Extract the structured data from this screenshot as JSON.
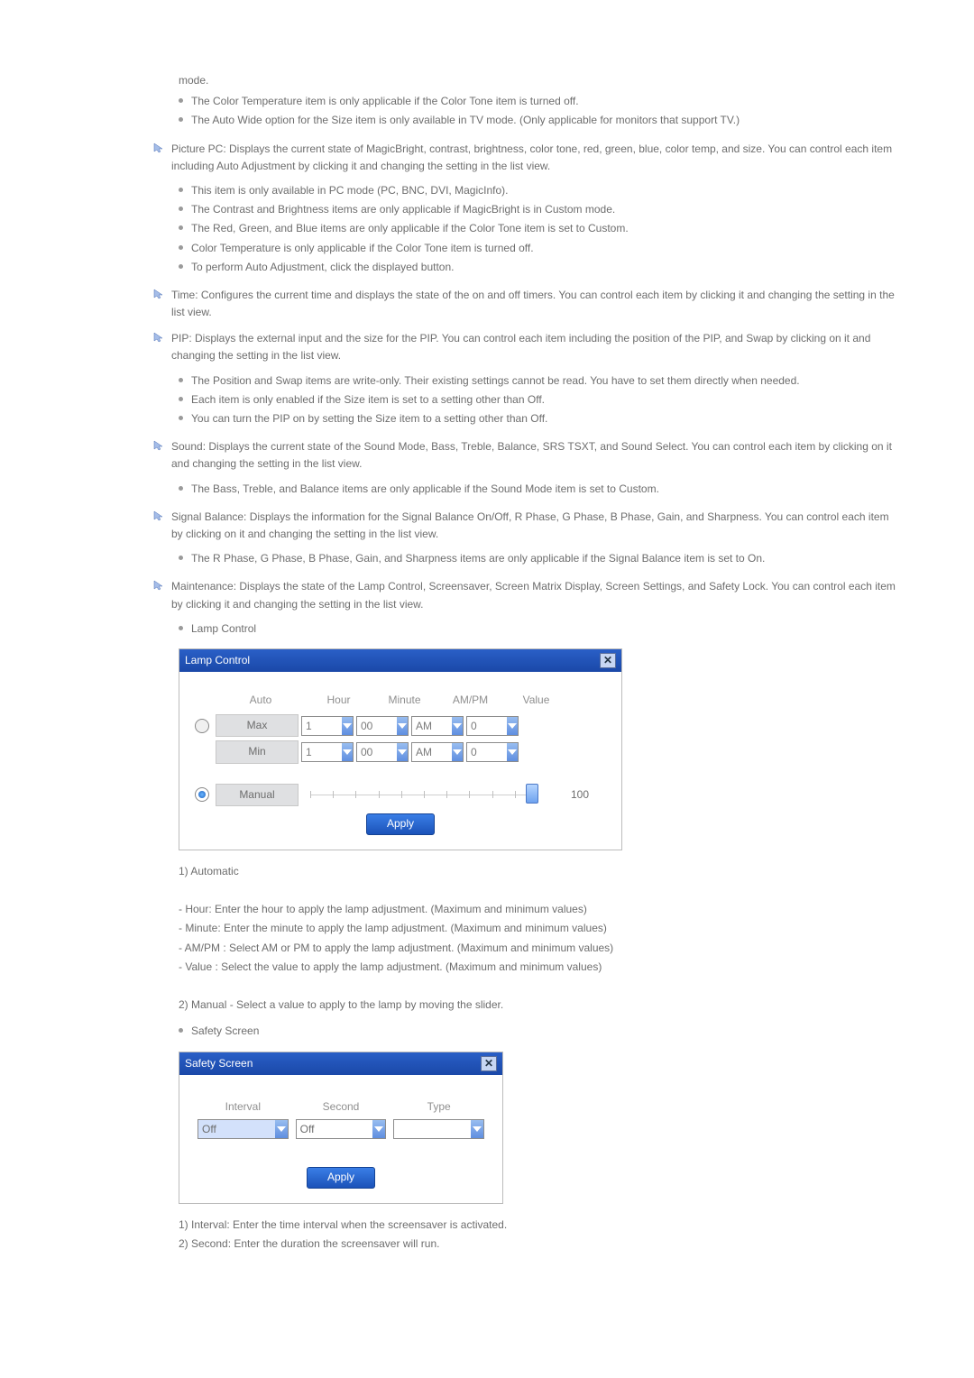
{
  "intro_tail_line": "mode.",
  "intro_bullets": [
    "The Color Temperature item is only applicable if the Color Tone item is turned off.",
    "The Auto Wide option for the Size item is only available in TV mode. (Only applicable for monitors that support TV.)"
  ],
  "sections": [
    {
      "lead": "Picture PC: Displays the current state of MagicBright, contrast, brightness, color tone, red, green, blue, color temp, and size. You can control each item including Auto Adjustment by clicking it and changing the setting in the list view.",
      "bullets": [
        "This item is only available in PC mode (PC, BNC, DVI, MagicInfo).",
        "The Contrast and Brightness items are only applicable if MagicBright is in Custom mode.",
        "The Red, Green, and Blue items are only applicable if the Color Tone item is set to Custom.",
        "Color Temperature is only applicable if the Color Tone item is turned off.",
        "To perform Auto Adjustment, click the displayed button."
      ]
    },
    {
      "lead": "Time: Configures the current time and displays the state of the on and off timers. You can control each item by clicking it and changing the setting in the list view.",
      "bullets": []
    },
    {
      "lead": "PIP: Displays the external input and the size for the PIP. You can control each item including the position of the PIP, and Swap by clicking on it and changing the setting in the list view.",
      "bullets": [
        "The Position and Swap items are write-only. Their existing settings cannot be read. You have to set them directly when needed.",
        "Each item is only enabled if the Size item is set to a setting other than Off.",
        "You can turn the PIP on by setting the Size item to a setting other than Off."
      ]
    },
    {
      "lead": "Sound: Displays the current state of the Sound Mode, Bass, Treble, Balance, SRS TSXT, and Sound Select. You can control each item by clicking on it and changing the setting in the list view.",
      "bullets": [
        "The Bass, Treble, and Balance items are only applicable if the Sound Mode item is set to Custom."
      ]
    },
    {
      "lead": "Signal Balance: Displays the information for the Signal Balance On/Off, R Phase, G Phase, B Phase, Gain, and Sharpness. You can control each item by clicking on it and changing the setting in the list view.",
      "bullets": [
        "The R Phase, G Phase, B Phase, Gain, and Sharpness items are only applicable if the Signal Balance item is set to On."
      ]
    },
    {
      "lead": "Maintenance: Displays the state of the Lamp Control, Screensaver, Screen Matrix Display, Screen Settings, and Safety Lock. You can control each item by clicking it and changing the setting in the list view.",
      "bullets": []
    }
  ],
  "lamp": {
    "section_label": "Lamp Control",
    "title": "Lamp Control",
    "headers": {
      "auto": "Auto",
      "hour": "Hour",
      "minute": "Minute",
      "ampm": "AM/PM",
      "value": "Value"
    },
    "rows": {
      "max": {
        "label": "Max",
        "hour": "1",
        "minute": "00",
        "ampm": "AM",
        "value": "0"
      },
      "min": {
        "label": "Min",
        "hour": "1",
        "minute": "00",
        "ampm": "AM",
        "value": "0"
      }
    },
    "manual_label": "Manual",
    "manual_value": "100",
    "apply": "Apply"
  },
  "lamp_notes": {
    "h1": "1) Automatic",
    "l1": "- Hour: Enter the hour to apply the lamp adjustment. (Maximum and minimum values)",
    "l2": "- Minute: Enter the minute to apply the lamp adjustment. (Maximum and minimum values)",
    "l3": "- AM/PM : Select AM or PM to apply the lamp adjustment. (Maximum and minimum values)",
    "l4": "- Value : Select the value to apply the lamp adjustment. (Maximum and minimum values)",
    "h2": "2) Manual - Select a value to apply to the lamp by moving the slider."
  },
  "safety": {
    "section_label": "Safety Screen",
    "title": "Safety Screen",
    "headers": {
      "interval": "Interval",
      "second": "Second",
      "type": "Type"
    },
    "values": {
      "interval": "Off",
      "second": "Off",
      "type": ""
    },
    "apply": "Apply"
  },
  "safety_notes": {
    "l1": "1) Interval: Enter the time interval when the screensaver is activated.",
    "l2": "2) Second: Enter the duration the screensaver will run."
  }
}
